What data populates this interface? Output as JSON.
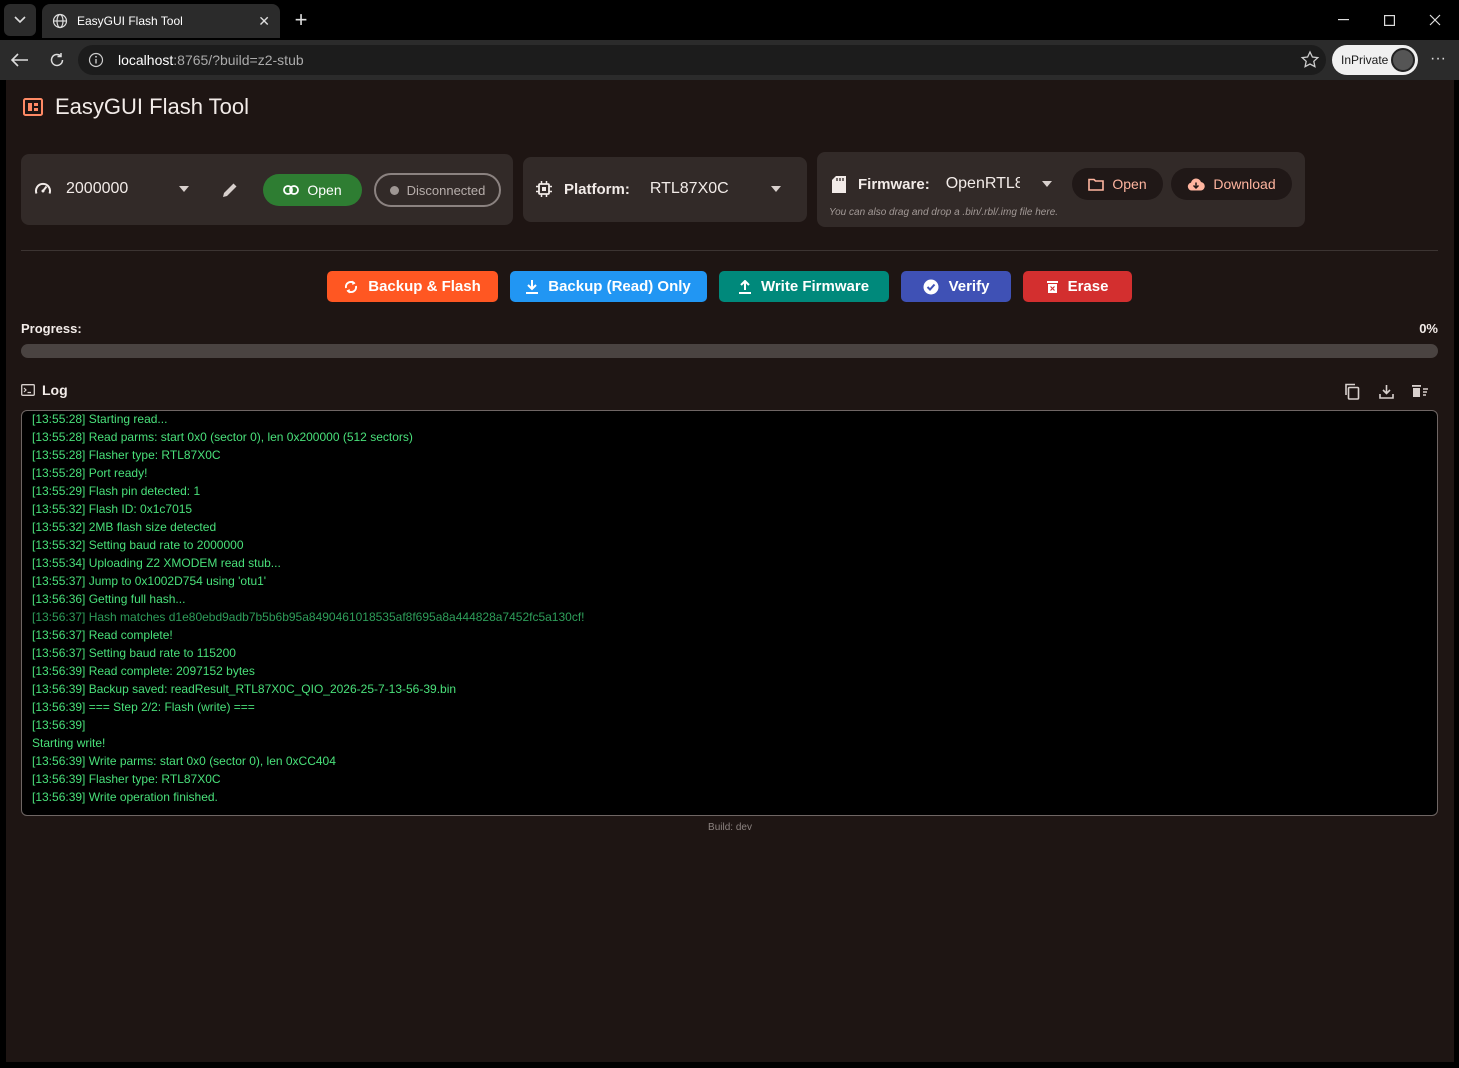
{
  "browser": {
    "tab_title": "EasyGUI Flash Tool",
    "url_host": "localhost",
    "url_rest": ":8765/?build=z2-stub",
    "inprivate_label": "InPrivate",
    "more_label": "···"
  },
  "app": {
    "title": "EasyGUI Flash Tool",
    "baud": {
      "value": "2000000"
    },
    "open_port_label": "Open",
    "status_label": "Disconnected",
    "platform": {
      "label": "Platform:",
      "value": "RTL87X0C"
    },
    "firmware": {
      "label": "Firmware:",
      "value": "OpenRTL8",
      "open_label": "Open",
      "download_label": "Download",
      "hint": "You can also drag and drop a .bin/.rbl/.img file here."
    },
    "actions": {
      "backup_flash": "Backup & Flash",
      "backup_only": "Backup (Read) Only",
      "write": "Write Firmware",
      "verify": "Verify",
      "erase": "Erase"
    },
    "progress": {
      "label": "Progress:",
      "percent_label": "0%",
      "value": 0
    },
    "log": {
      "title": "Log",
      "lines": [
        "[13:55:28] Starting read...",
        "[13:55:28] Read parms: start 0x0 (sector 0), len 0x200000 (512 sectors)",
        "[13:55:28] Flasher type: RTL87X0C",
        "[13:55:28] Port ready!",
        "[13:55:29] Flash pin detected: 1",
        "[13:55:32] Flash ID: 0x1c7015",
        "[13:55:32] 2MB flash size detected",
        "[13:55:32] Setting baud rate to 2000000",
        "[13:55:34] Uploading Z2 XMODEM read stub...",
        "[13:55:37] Jump to 0x1002D754 using 'otu1'",
        "[13:56:36] Getting full hash...",
        "[13:56:37] Hash matches d1e80ebd9adb7b5b6b95a8490461018535af8f695a8a444828a7452fc5a130cf!",
        "[13:56:37] Read complete!",
        "[13:56:37] Setting baud rate to 115200",
        "[13:56:39] Read complete: 2097152 bytes",
        "[13:56:39] Backup saved: readResult_RTL87X0C_QIO_2026-25-7-13-56-39.bin",
        "[13:56:39] === Step 2/2: Flash (write) ===",
        "[13:56:39] ",
        "Starting write!",
        "[13:56:39] Write parms: start 0x0 (sector 0), len 0xCC404",
        "[13:56:39] Flasher type: RTL87X0C",
        "[13:56:39] Write operation finished."
      ]
    },
    "build_label": "Build: dev"
  },
  "colors": {
    "backup_flash": "#ff5722",
    "backup_only": "#2196f3",
    "write": "#00897b",
    "verify": "#3f51b5",
    "erase": "#d32f2f",
    "log_text": "#49e07a"
  }
}
